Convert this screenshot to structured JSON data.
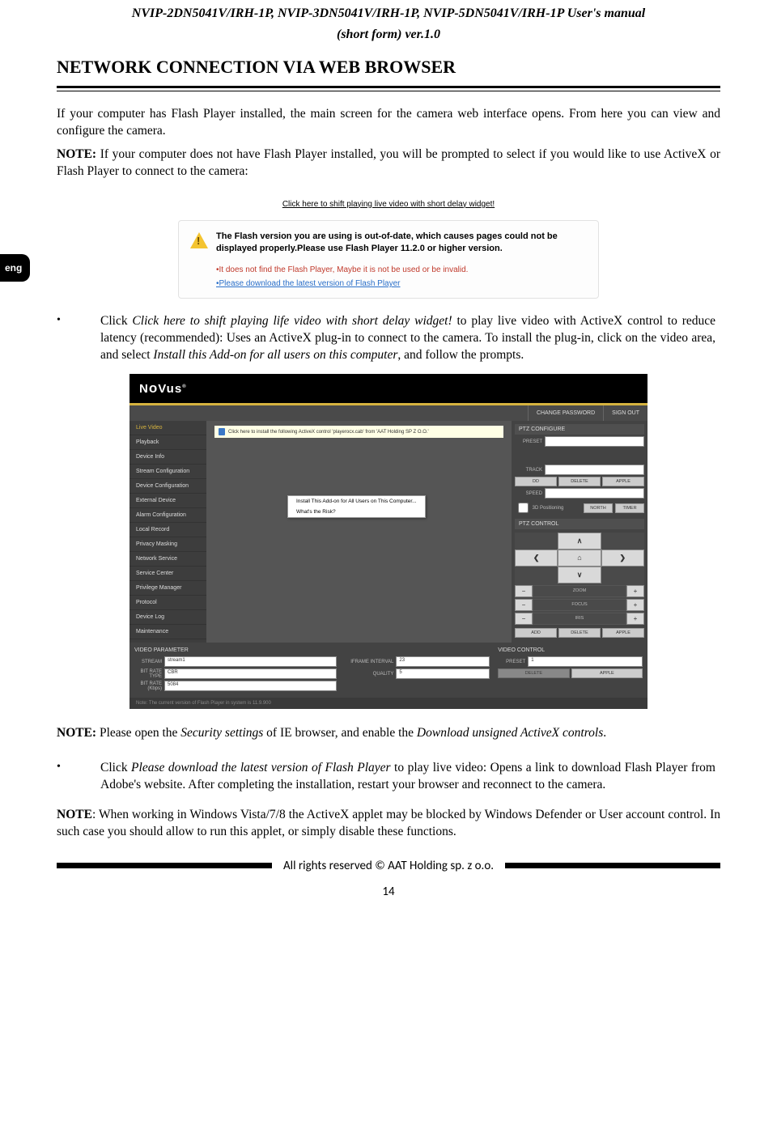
{
  "header": {
    "line1": "NVIP-2DN5041V/IRH-1P, NVIP-3DN5041V/IRH-1P, NVIP-5DN5041V/IRH-1P User's manual",
    "line2": "(short form) ver.1.0"
  },
  "section_title": "NETWORK CONNECTION VIA WEB BROWSER",
  "lang_tab": "eng",
  "intro": {
    "p1": "If your computer has Flash Player installed, the main screen for the camera web interface opens. From here you can view and configure the camera.",
    "p2a": "NOTE:",
    "p2b": " If your computer does not have Flash Player installed, you will be prompted to select if you would like to use ActiveX or Flash Player to connect to the camera:"
  },
  "shift_link": "Click here to shift playing live video with short delay widget!",
  "dialog": {
    "bold": "The Flash version you are using is out-of-date, which causes pages could not be displayed properly.Please use Flash Player 11.2.0 or higher version.",
    "red": "•It does not find the Flash Player, Maybe it is not be used or be invalid.",
    "blue": "•Please download the latest version of Flash Player"
  },
  "bullet1": {
    "lead": "Click ",
    "i1": "Click here to shift playing life video with short delay widget!",
    "mid": " to play live video with ActiveX control to reduce latency (recommended): Uses an ActiveX plug-in to connect to the camera. To install the plug-in, click on the video area, and select ",
    "i2": "Install this Add-on for all users on this computer",
    "tail": ", and follow the prompts."
  },
  "novus": {
    "logo": "NoVus",
    "topbar": {
      "chpw": "CHANGE PASSWORD",
      "signout": "SIGN OUT"
    },
    "side": [
      "Live Video",
      "Playback",
      "Device Info",
      "Stream Configuration",
      "Device Configuration",
      "External Device",
      "Alarm Configuration",
      "Local Record",
      "Privacy Masking",
      "Network Service",
      "Service Center",
      "Privilege Manager",
      "Protocol",
      "Device Log",
      "Maintenance"
    ],
    "activex_bar": "Click here to install the following ActiveX control 'playerocx.cab' from 'AAT Holding SP Z O.O.'",
    "ctx": {
      "a": "Install This Add-on for All Users on This Computer...",
      "b": "What's the Risk?"
    },
    "ptzconf": {
      "title": "PTZ CONFIGURE",
      "preset": "PRESET",
      "track": "TRACK",
      "speed": "SPEED",
      "pos": "3D Positioning",
      "north": "NORTH",
      "timer": "TIMER",
      "dd": "DD",
      "delete": "DELETE",
      "apple": "APPLE"
    },
    "ptzctrl": {
      "title": "PTZ CONTROL",
      "zoom": "ZOOM",
      "focus": "FOCUS",
      "iris": "IRIS",
      "add": "ADD",
      "delete": "DELETE",
      "apple": "APPLE"
    },
    "vparam": {
      "title": "VIDEO PARAMETER",
      "stream_l": "STREAM",
      "stream_v": "stream1",
      "brt_l": "BIT RATE TYPE",
      "brt_v": "CBR",
      "brk_l": "BIT RATE (Kbps)",
      "brk_v": "5084",
      "ifi_l": "IFRAME INTERVAL",
      "ifi_v": "23",
      "q_l": "QUALITY",
      "q_v": "5"
    },
    "vctrl": {
      "title": "VIDEO CONTROL",
      "preset_l": "PRESET",
      "preset_v": "1",
      "delete": "DELETE",
      "apple": "APPLE"
    },
    "footnote": "Note: The current version of Flash Player in system is 11.9.900"
  },
  "note2": {
    "a": "NOTE:",
    "b": " Please open the ",
    "c": "Security settings",
    "d": " of IE browser, and enable the ",
    "e": "Download unsigned ActiveX controls",
    "f": "."
  },
  "bullet2": {
    "lead": "Click ",
    "i": "Please download the latest version of Flash Player",
    "tail": " to play live video: Opens a link to download Flash Player from Adobe's website. After completing the installation, restart your browser and reconnect to the camera."
  },
  "note3": {
    "a": "NOTE",
    "b": ": When working in Windows Vista/7/8 the ActiveX applet may be blocked by Windows Defender or User account control. In such case you should allow to run this applet, or simply disable these functions."
  },
  "footer": "All rights reserved © AAT Holding sp. z o.o.",
  "page": "14"
}
